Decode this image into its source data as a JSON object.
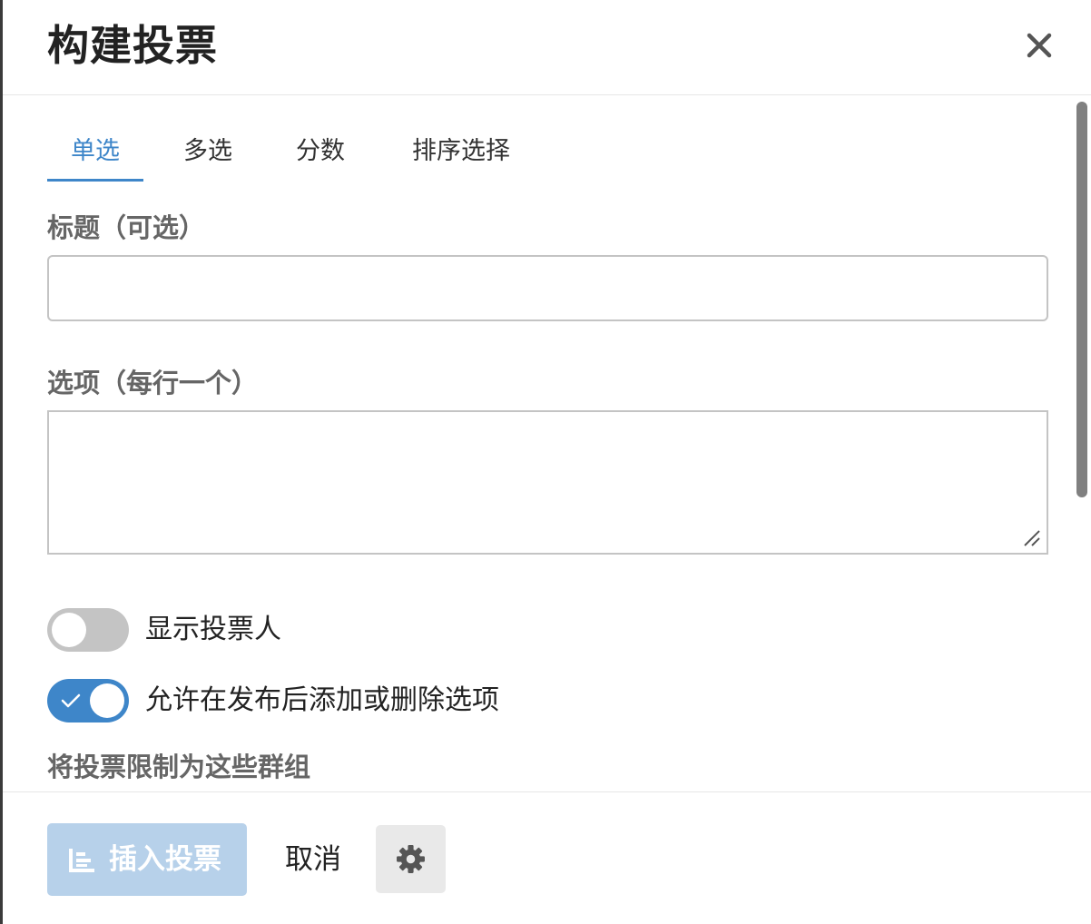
{
  "dialog": {
    "title": "构建投票"
  },
  "tabs": [
    {
      "label": "单选",
      "active": true
    },
    {
      "label": "多选",
      "active": false
    },
    {
      "label": "分数",
      "active": false
    },
    {
      "label": "排序选择",
      "active": false
    }
  ],
  "form": {
    "title_label": "标题（可选）",
    "title_value": "",
    "options_label": "选项（每行一个）",
    "options_value": "",
    "show_voters_label": "显示投票人",
    "show_voters_on": false,
    "allow_edit_label": "允许在发布后添加或删除选项",
    "allow_edit_on": true,
    "limit_groups_label": "将投票限制为这些群组"
  },
  "footer": {
    "insert_label": "插入投票",
    "cancel_label": "取消"
  },
  "colors": {
    "accent": "#3e86c9",
    "accent_disabled": "#b7d1ea",
    "toggle_off": "#c4c4c4"
  },
  "icons": {
    "close": "close-icon",
    "insert": "bar-chart-icon",
    "settings": "gear-icon",
    "check": "check-icon",
    "resize": "resize-grip-icon"
  }
}
